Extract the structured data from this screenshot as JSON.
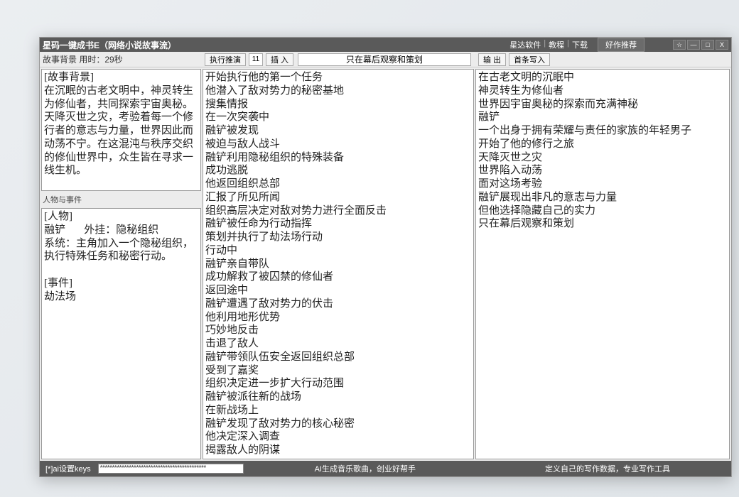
{
  "titlebar": {
    "title": "星码一键成书E（网络小说故事流）",
    "nav": [
      "星达软件",
      "教程",
      "下载"
    ],
    "recommend_btn": "好作推荐",
    "win_star": "☆",
    "win_min": "—",
    "win_max": "□",
    "win_close": "X"
  },
  "toolbar": {
    "left_label": "故事背景 用时：29秒",
    "exec_btn": "执行推演",
    "exec_num": "11",
    "insert_btn": "插 入",
    "center_text": "只在幕后观察和策划",
    "output_btn": "输 出",
    "first_btn": "首条写入"
  },
  "left": {
    "box1_label": "",
    "box1_text": "[故事背景]\n在沉眠的古老文明中，神灵转生为修仙者，共同探索宇宙奥秘。天降灭世之灾，考验着每一个修行者的意志与力量，世界因此而动荡不宁。在这混沌与秩序交织的修仙世界中，众生皆在寻求一线生机。",
    "box2_label": "人物与事件",
    "box2_text": "[人物]\n融铲       外挂：隐秘组织\n系统：主角加入一个隐秘组织，执行特殊任务和秘密行动。\n\n[事件]\n劫法场"
  },
  "mid": {
    "text": "开始执行他的第一个任务\n他潜入了敌对势力的秘密基地\n搜集情报\n在一次突袭中\n融铲被发现\n被迫与敌人战斗\n融铲利用隐秘组织的特殊装备\n成功逃脱\n他返回组织总部\n汇报了所见所闻\n组织高层决定对敌对势力进行全面反击\n融铲被任命为行动指挥\n策划并执行了劫法场行动\n行动中\n融铲亲自带队\n成功解救了被囚禁的修仙者\n返回途中\n融铲遭遇了敌对势力的伏击\n他利用地形优势\n巧妙地反击\n击退了敌人\n融铲带领队伍安全返回组织总部\n受到了嘉奖\n组织决定进一步扩大行动范围\n融铲被派往新的战场\n在新战场上\n融铲发现了敌对势力的核心秘密\n他决定深入调查\n揭露敌人的阴谋"
  },
  "right": {
    "text": "在古老文明的沉眠中\n神灵转生为修仙者\n世界因宇宙奥秘的探索而充满神秘\n融铲\n一个出身于拥有荣耀与责任的家族的年轻男子\n开始了他的修行之旅\n天降灭世之灾\n世界陷入动荡\n面对这场考验\n融铲展现出非凡的意志与力量\n但他选择隐藏自己的实力\n只在幕后观察和策划"
  },
  "footer": {
    "keys_label": "[*]ai设置keys",
    "keys_value": "********************************************",
    "center": "AI生成音乐歌曲，创业好帮手",
    "right": "定义自己的写作数据，专业写作工具"
  }
}
